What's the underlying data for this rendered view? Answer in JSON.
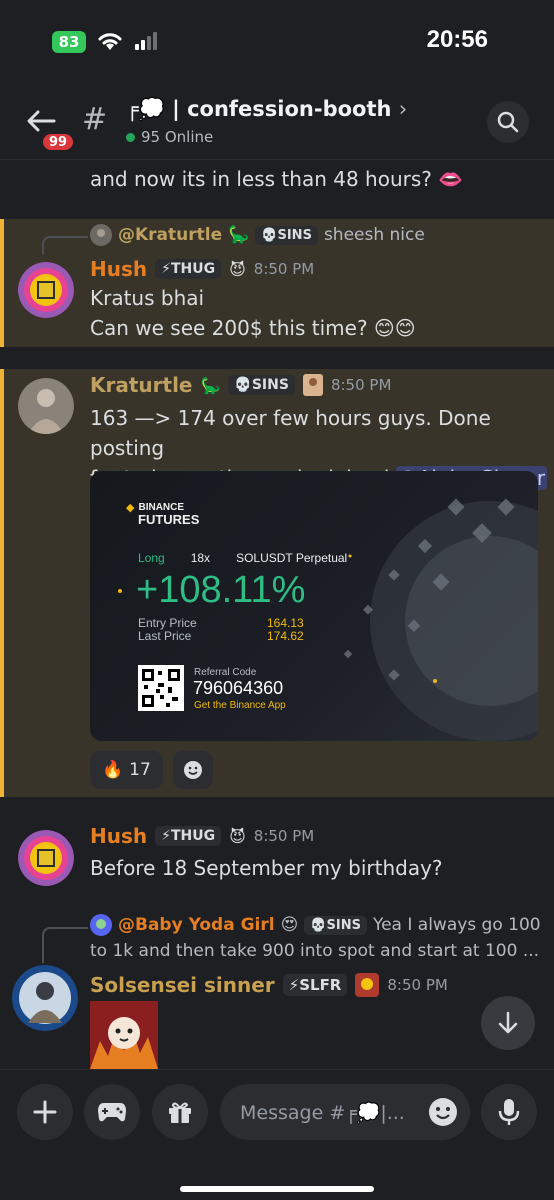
{
  "status_bar": {
    "battery": "83",
    "time": "20:56"
  },
  "header": {
    "badge_count": "99",
    "channel_prefix": "╒💭 |",
    "channel_name": "confession-booth",
    "online": "95 Online"
  },
  "messages": [
    {
      "type": "continuation",
      "text": "and now its in less than 48 hours? 👄"
    },
    {
      "type": "reply",
      "reply_to": {
        "name": "@Kraturtle",
        "name_emoji": "🦕",
        "role": "💀SINS",
        "text": "sheesh nice"
      },
      "author": "Hush",
      "author_color": "#e67e22",
      "role": "⚡THUG",
      "role_emoji": "😈",
      "time": "8:50 PM",
      "lines": [
        "Kratus bhai",
        "Can we see 200$ this time? 😊😊"
      ]
    },
    {
      "type": "post",
      "author": "Kraturtle",
      "author_color": "#c0a060",
      "author_emoji": "🦕",
      "role": "💀SINS",
      "time": "8:50 PM",
      "lines": [
        "163 —> 174 over few hours guys. Done posting",
        "for today gg those who joined"
      ],
      "mention": "@Alpha Sinner",
      "card": {
        "brand": "BINANCE",
        "product": "FUTURES",
        "side": "Long",
        "leverage": "18x",
        "pair": "SOLUSDT Perpetual",
        "pnl": "+108.11%",
        "entry_label": "Entry Price",
        "entry_value": "164.13",
        "last_label": "Last Price",
        "last_value": "174.62",
        "ref_label": "Referral Code",
        "ref_code": "796064360",
        "app_text": "Get the Binance App"
      },
      "reactions": [
        {
          "emoji": "🔥",
          "count": "17"
        }
      ]
    },
    {
      "type": "post",
      "author": "Hush",
      "author_color": "#e67e22",
      "role": "⚡THUG",
      "role_emoji": "😈",
      "time": "8:50 PM",
      "lines": [
        "Before 18 September my birthday?"
      ]
    },
    {
      "type": "reply",
      "reply_to": {
        "name": "@Baby Yoda Girl",
        "name_emoji": "😍",
        "role": "💀SINS",
        "text": "Yea I always go 100",
        "text2": "to 1k and then take 900 into spot and start at 100 ..."
      },
      "author": "Solsensei sinner",
      "author_color": "#c9a050",
      "role": "⚡SLFR",
      "time": "8:50 PM"
    }
  ],
  "composer": {
    "placeholder": "Message #╒💭|..."
  },
  "colors": {
    "background": "#1e1f22",
    "highlight": "#383429",
    "highlight_bar": "#f0b232",
    "online": "#23a55a",
    "badge": "#da373c",
    "pnl_green": "#2ebd85",
    "binance_yellow": "#f0b90b"
  }
}
